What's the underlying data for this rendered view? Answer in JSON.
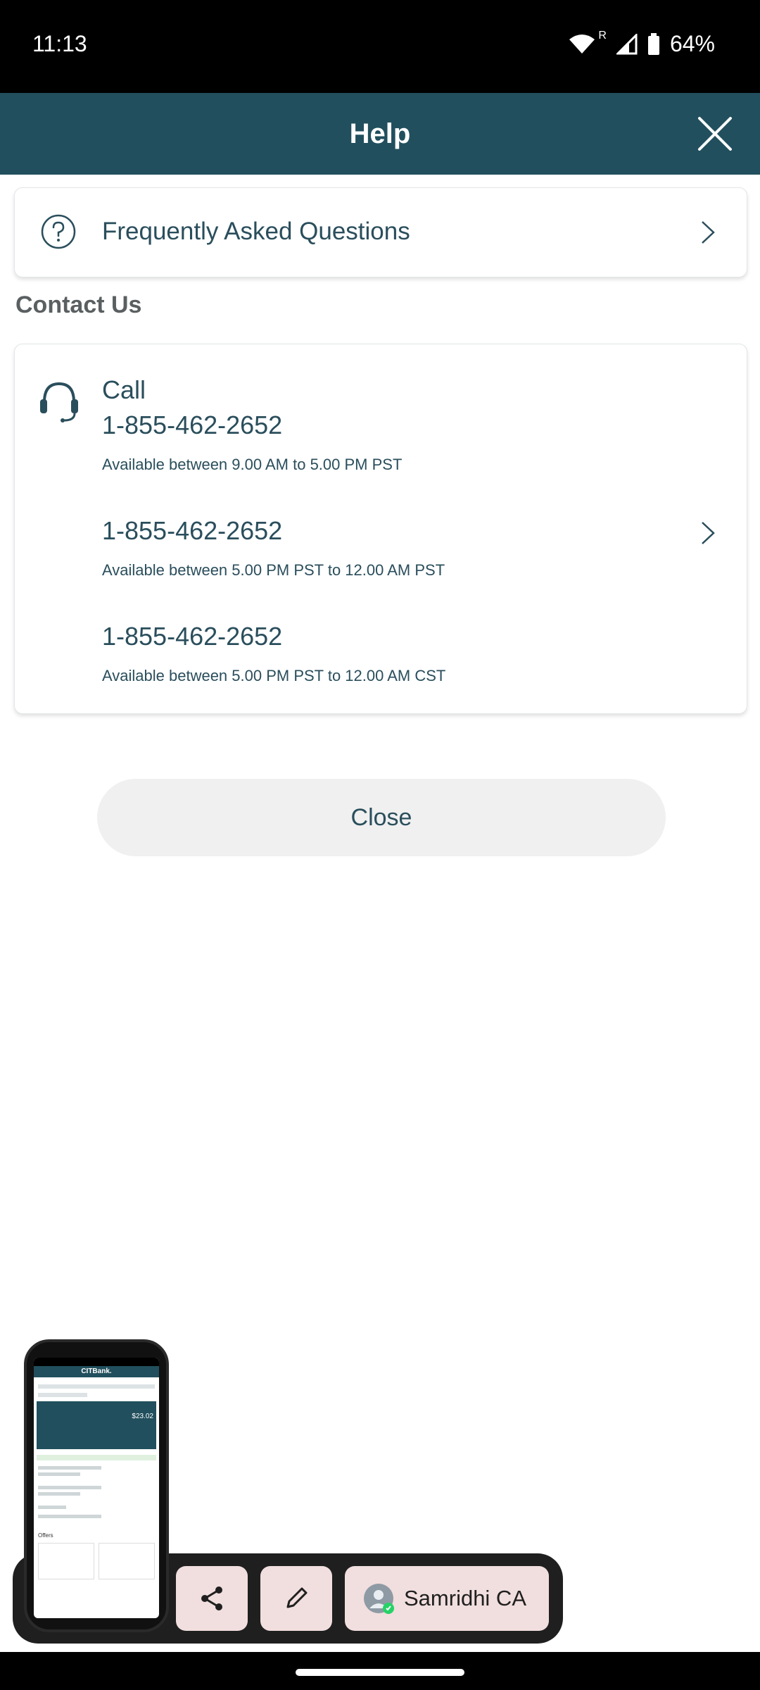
{
  "status_bar": {
    "time": "11:13",
    "roaming": "R",
    "battery": "64%"
  },
  "app_bar": {
    "title": "Help"
  },
  "faq": {
    "label": "Frequently Asked Questions"
  },
  "contact": {
    "section_title": "Contact Us",
    "call_label": "Call",
    "numbers": [
      {
        "phone": "1-855-462-2652",
        "availability": "Available between 9.00 AM to 5.00 PM PST"
      },
      {
        "phone": "1-855-462-2652",
        "availability": "Available between 5.00 PM PST to 12.00 AM PST"
      },
      {
        "phone": "1-855-462-2652",
        "availability": "Available between 5.00 PM PST to 12.00 AM CST"
      }
    ]
  },
  "close_button": "Close",
  "screenshot_toolbar": {
    "contact_name": "Samridhi CA",
    "thumbnail_brand": "CITBank.",
    "thumbnail_balance": "$23.02",
    "thumbnail_offers": "Offers"
  },
  "colors": {
    "app_bar": "#214f5d",
    "text_primary": "#2a4e5c",
    "dock_button": "#f1dede"
  }
}
